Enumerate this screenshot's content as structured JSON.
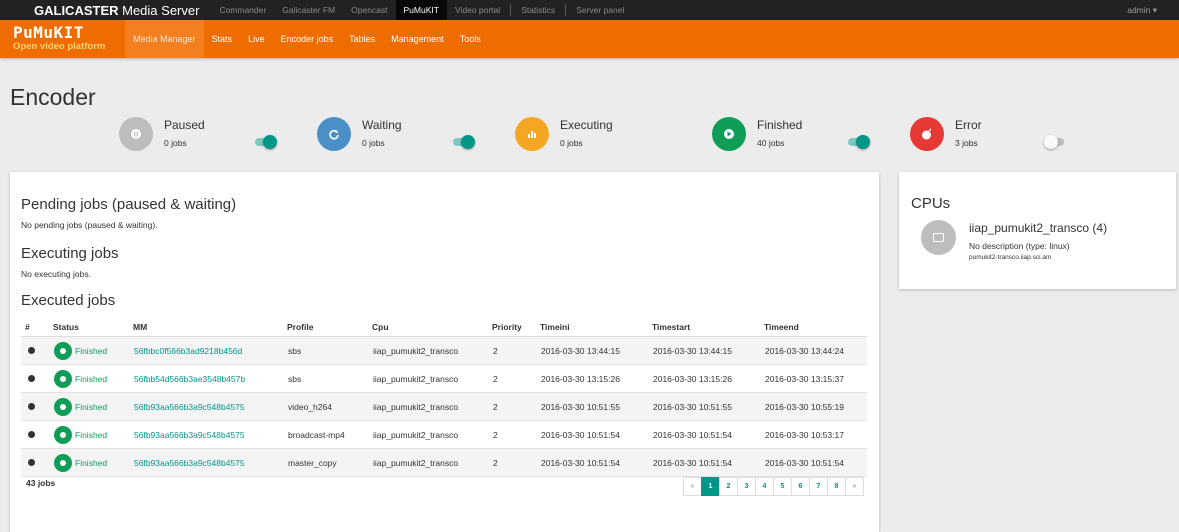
{
  "topbar": {
    "brand_bold": "GALICASTER",
    "brand_light": "Media Server",
    "items": [
      "Commander",
      "Galicaster FM",
      "Opencast",
      "PuMuKIT",
      "Video portal",
      "Statistics",
      "Server panel"
    ],
    "active_item": "PuMuKIT",
    "user": "admin ▾"
  },
  "logo": {
    "title": "PuMuKIT",
    "subtitle": "Open video platform"
  },
  "mainnav": {
    "items": [
      "Media Manager",
      "Stats",
      "Live",
      "Encoder jobs",
      "Tables",
      "Management",
      "Tools"
    ],
    "active_item": "Media Manager"
  },
  "page_title": "Encoder",
  "statuses": [
    {
      "label": "Paused",
      "count": "0 jobs",
      "color": "#bdbdbd",
      "icon": "pause-icon",
      "toggle": true
    },
    {
      "label": "Waiting",
      "count": "0 jobs",
      "color": "#4a90c6",
      "icon": "refresh-icon",
      "toggle": true
    },
    {
      "label": "Executing",
      "count": "0 jobs",
      "color": "#f5a623",
      "icon": "bar-chart-icon",
      "toggle": null
    },
    {
      "label": "Finished",
      "count": "40 jobs",
      "color": "#0f9d58",
      "icon": "play-icon",
      "toggle": true
    },
    {
      "label": "Error",
      "count": "3 jobs",
      "color": "#e53935",
      "icon": "bomb-icon",
      "toggle": false
    }
  ],
  "pending": {
    "title": "Pending jobs (paused & waiting)",
    "text": "No pending jobs (paused & waiting)."
  },
  "executing": {
    "title": "Executing jobs",
    "text": "No executing jobs."
  },
  "executed": {
    "title": "Executed jobs",
    "columns": [
      "#",
      "Status",
      "MM",
      "Profile",
      "Cpu",
      "Priority",
      "Timeini",
      "Timestart",
      "Timeend"
    ],
    "rows": [
      {
        "status": "Finished",
        "mm": "56fbbc0f566b3ad9218b456d",
        "profile": "sbs",
        "cpu": "iiap_pumukit2_transco",
        "priority": "2",
        "timeini": "2016-03-30 13:44:15",
        "timestart": "2016-03-30 13:44:15",
        "timeend": "2016-03-30 13:44:24"
      },
      {
        "status": "Finished",
        "mm": "56fbb54d566b3ae3548b457b",
        "profile": "sbs",
        "cpu": "iiap_pumukit2_transco",
        "priority": "2",
        "timeini": "2016-03-30 13:15:26",
        "timestart": "2016-03-30 13:15:26",
        "timeend": "2016-03-30 13:15:37"
      },
      {
        "status": "Finished",
        "mm": "56fb93aa566b3a9c548b4575",
        "profile": "video_h264",
        "cpu": "iiap_pumukit2_transco",
        "priority": "2",
        "timeini": "2016-03-30 10:51:55",
        "timestart": "2016-03-30 10:51:55",
        "timeend": "2016-03-30 10:55:19"
      },
      {
        "status": "Finished",
        "mm": "56fb93aa566b3a9c548b4575",
        "profile": "broadcast-mp4",
        "cpu": "iiap_pumukit2_transco",
        "priority": "2",
        "timeini": "2016-03-30 10:51:54",
        "timestart": "2016-03-30 10:51:54",
        "timeend": "2016-03-30 10:53:17"
      },
      {
        "status": "Finished",
        "mm": "56fb93aa566b3a9c548b4575",
        "profile": "master_copy",
        "cpu": "iiap_pumukit2_transco",
        "priority": "2",
        "timeini": "2016-03-30 10:51:54",
        "timestart": "2016-03-30 10:51:54",
        "timeend": "2016-03-30 10:51:54"
      }
    ],
    "total": "43 jobs",
    "pagination": {
      "prev": "«",
      "pages": [
        "1",
        "2",
        "3",
        "4",
        "5",
        "6",
        "7",
        "8"
      ],
      "active": "1",
      "next": "»"
    }
  },
  "cpus": {
    "title": "CPUs",
    "name": "iiap_pumukit2_transco (4)",
    "description": "No description (type: linux)",
    "host": "pumukit2-transco.iiap.sci.am"
  },
  "colors": {
    "orange": "#ef6c00",
    "teal": "#009688",
    "green": "#0f9d58"
  }
}
